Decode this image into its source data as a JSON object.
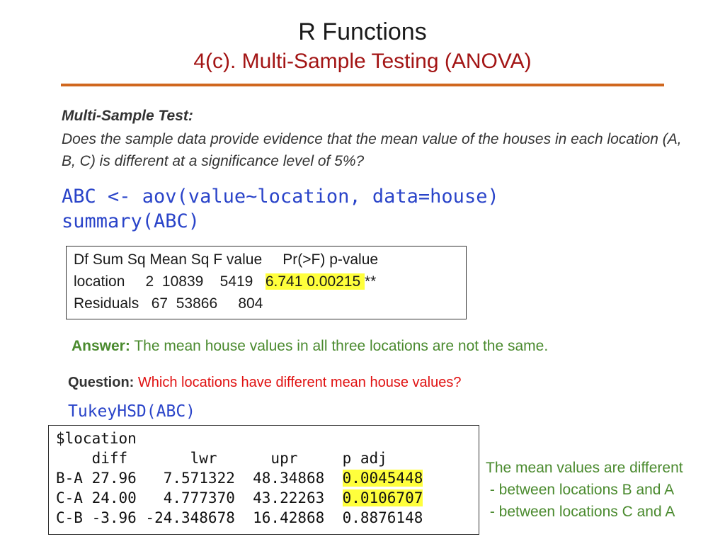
{
  "slide": {
    "title": "R Functions",
    "subtitle": "4(c). Multi-Sample Testing (ANOVA)"
  },
  "problem": {
    "heading": "Multi-Sample Test:",
    "body": "Does the sample data provide evidence that the mean value of the houses in each location (A, B, C) is different at a significance level of 5%?"
  },
  "code1": {
    "line1": "ABC <- aov(value~location, data=house)",
    "line2": "summary(ABC)"
  },
  "anova_output": {
    "header": "Df Sum Sq Mean Sq F value     Pr(>F) p-value",
    "row1_pre": "location     2  10839    5419   ",
    "row1_highlight": "6.741 0.00215 ",
    "row1_post": "**",
    "row2": "Residuals   67  53866     804"
  },
  "answer": {
    "label": "Answer:",
    "text": " The mean house values in all three locations are not the same."
  },
  "question": {
    "label": "Question:",
    "text": " Which locations have different mean house values?"
  },
  "code2": {
    "line1": "TukeyHSD(ABC)"
  },
  "tukey_output": {
    "line1": "$location",
    "header": "    diff       lwr      upr     p adj",
    "rows": [
      {
        "pre": "B-A 27.96   7.571322  48.34868  ",
        "p": "0.0045448",
        "highlight": true
      },
      {
        "pre": "C-A 24.00   4.777370  43.22263  ",
        "p": "0.0106707",
        "highlight": true
      },
      {
        "pre": "C-B -3.96 -24.348678  16.42868  ",
        "p": "0.8876148",
        "highlight": false
      }
    ]
  },
  "note": {
    "line1": "The mean values are different",
    "line2": " - between locations B and A",
    "line3": " - between locations C and A"
  }
}
